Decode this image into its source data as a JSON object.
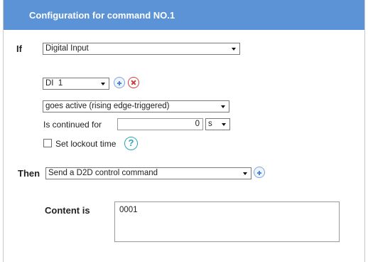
{
  "header": {
    "title": "Configuration for command NO.1"
  },
  "if_section": {
    "label": "If",
    "trigger_select": "Digital Input",
    "channel_select": "DI  1",
    "condition_select": "goes active (rising edge-triggered)",
    "continued_label": "Is continued for",
    "continued_value": "0",
    "unit_select": "s",
    "lockout_label": "Set lockout time",
    "lockout_checked": false,
    "help_symbol": "?"
  },
  "then_section": {
    "label": "Then",
    "action_select": "Send a D2D control command"
  },
  "content": {
    "label": "Content is",
    "value": "0001"
  },
  "icons": {
    "add": "plus-circle-icon",
    "remove": "x-circle-icon",
    "help": "question-circle-icon",
    "dropdown": "chevron-down-icon"
  },
  "colors": {
    "header_bg": "#5b93d6",
    "add_icon": "#4f86cf",
    "remove_icon": "#d43b3b",
    "help_icon": "#2aa6b8"
  }
}
